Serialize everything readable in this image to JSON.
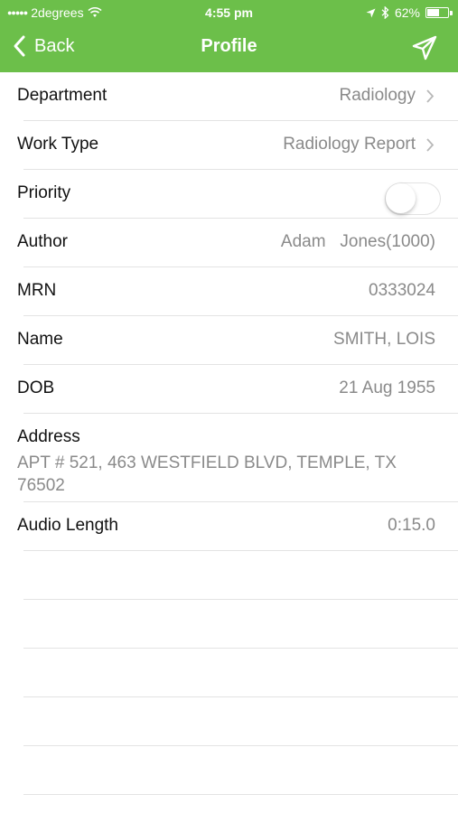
{
  "status_bar": {
    "signal_dots": "●●●●●",
    "carrier": "2degrees",
    "time": "4:55 pm",
    "battery_text": "62%",
    "battery_level": 0.62
  },
  "nav": {
    "back_label": "Back",
    "title": "Profile"
  },
  "rows": {
    "department": {
      "label": "Department",
      "value": "Radiology"
    },
    "work_type": {
      "label": "Work Type",
      "value": "Radiology Report"
    },
    "priority": {
      "label": "Priority",
      "enabled": false
    },
    "author": {
      "label": "Author",
      "value": "Adam   Jones(1000)"
    },
    "mrn": {
      "label": "MRN",
      "value": "0333024"
    },
    "name": {
      "label": "Name",
      "value": "SMITH, LOIS"
    },
    "dob": {
      "label": "DOB",
      "value": "21 Aug 1955"
    },
    "address": {
      "label": "Address",
      "value": "APT # 521, 463 WESTFIELD BLVD, TEMPLE, TX 76502"
    },
    "audio_length": {
      "label": "Audio Length",
      "value": "0:15.0"
    }
  },
  "colors": {
    "header": "#6cbf4a",
    "value_text": "#8a8a8a",
    "separator": "#e3e3e3"
  },
  "icons": {
    "back": "chevron-left-icon",
    "send": "paper-plane-icon",
    "row_disclosure": "chevron-right-icon"
  }
}
